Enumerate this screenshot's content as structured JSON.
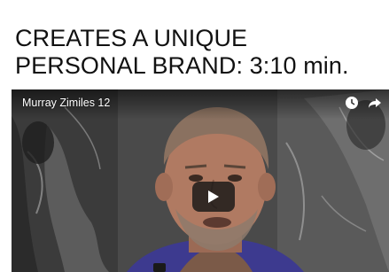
{
  "heading": {
    "line1": "CREATES A UNIQUE",
    "line2": "PERSONAL BRAND:  3:10 min."
  },
  "video": {
    "title": "Murray Zimiles 12",
    "icons": [
      "clock-icon",
      "share-icon",
      "play-icon"
    ]
  }
}
